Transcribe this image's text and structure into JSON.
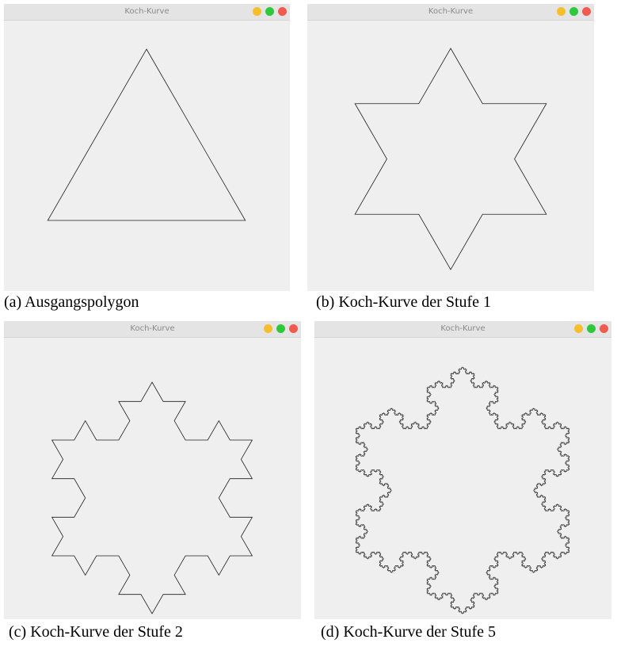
{
  "colors": {
    "minimize": "#f5be2d",
    "maximize": "#2dc83c",
    "close": "#f05a4f",
    "line": "#1e1e1e"
  },
  "windows": [
    {
      "title": "Koch-Kurve",
      "level": 0,
      "caption": "(a) Ausgangspolygon"
    },
    {
      "title": "Koch-Kurve",
      "level": 1,
      "caption": "(b) Koch-Kurve der Stufe 1"
    },
    {
      "title": "Koch-Kurve",
      "level": 2,
      "caption": "(c) Koch-Kurve der Stufe 2"
    },
    {
      "title": "Koch-Kurve",
      "level": 5,
      "caption": "(d) Koch-Kurve der Stufe 5"
    }
  ]
}
